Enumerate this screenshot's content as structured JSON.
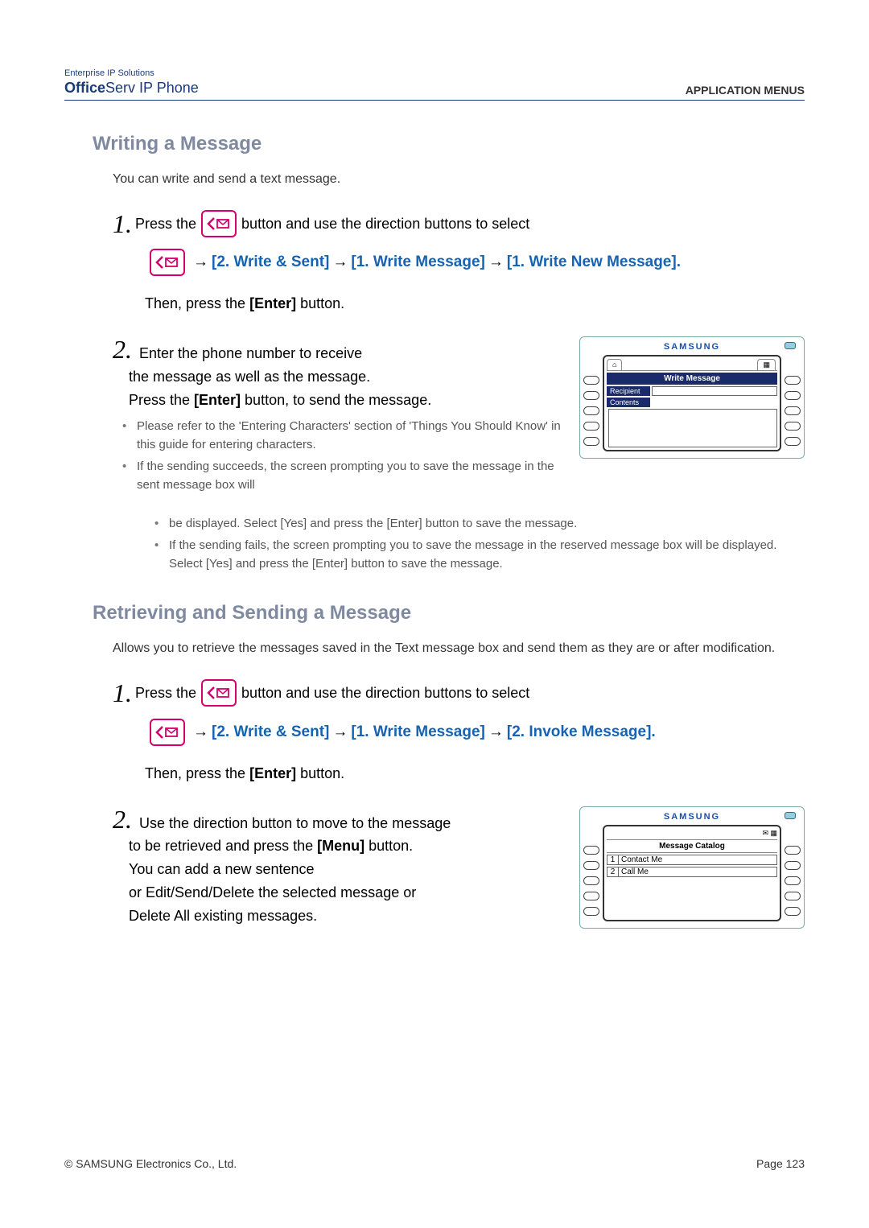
{
  "header": {
    "brand_top": "Enterprise IP Solutions",
    "brand_bold": "Office",
    "brand_rest": "Serv IP Phone",
    "right": "APPLICATION MENUS"
  },
  "s1": {
    "title": "Writing a Message",
    "intro": "You can write and send a text message.",
    "step1_a": "Press the",
    "step1_b": "button and use the direction buttons to select",
    "path1": "[2. Write & Sent]",
    "path2": "[1. Write Message]",
    "path3": "[1. Write New Message].",
    "enter": "Then, press the [Enter] button.",
    "step2_1": "Enter the phone number to receive",
    "step2_2": "the message as well as the message.",
    "step2_3": "Press the [Enter] button, to send the message.",
    "b1": "Please refer to the 'Entering Characters' section of 'Things You Should Know' in this guide for entering characters.",
    "b2": "If the sending succeeds, the screen prompting you to save the message in the sent message box will be displayed. Select [Yes] and press the [Enter] button to save the message.",
    "b3": "If the sending fails, the screen prompting you to save the message in the reserved message box will be displayed. Select [Yes] and press the [Enter] button to save the message."
  },
  "phone1": {
    "brand": "SAMSUNG",
    "title": "Write Message",
    "f1": "Recipient",
    "f2": "Contents"
  },
  "s2": {
    "title": "Retrieving and Sending a Message",
    "intro": "Allows you to retrieve the messages saved in the Text message box and send them as they are or after modification.",
    "step1_a": "Press the",
    "step1_b": "button and use the direction buttons to select",
    "path1": "[2. Write & Sent]",
    "path2": "[1. Write Message]",
    "path3": "[2. Invoke Message].",
    "enter": "Then, press the [Enter] button.",
    "step2_1": "Use the direction button to move to the message",
    "step2_2": "to be retrieved and press the [Menu] button.",
    "step2_3": "You can add a new sentence",
    "step2_4": "or Edit/Send/Delete the selected message or",
    "step2_5": "Delete All existing messages."
  },
  "phone2": {
    "brand": "SAMSUNG",
    "title": "Message Catalog",
    "row1_n": "1",
    "row1_t": "Contact Me",
    "row2_n": "2",
    "row2_t": "Call Me"
  },
  "footer": {
    "left": "© SAMSUNG Electronics Co., Ltd.",
    "right": "Page 123"
  }
}
